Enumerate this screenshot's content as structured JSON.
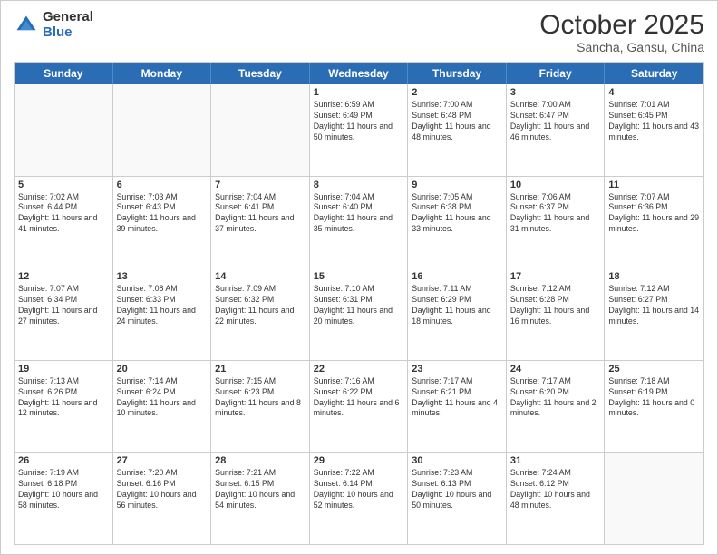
{
  "header": {
    "logo_general": "General",
    "logo_blue": "Blue",
    "month": "October 2025",
    "location": "Sancha, Gansu, China"
  },
  "weekdays": [
    "Sunday",
    "Monday",
    "Tuesday",
    "Wednesday",
    "Thursday",
    "Friday",
    "Saturday"
  ],
  "weeks": [
    [
      {
        "day": "",
        "text": ""
      },
      {
        "day": "",
        "text": ""
      },
      {
        "day": "",
        "text": ""
      },
      {
        "day": "1",
        "text": "Sunrise: 6:59 AM\nSunset: 6:49 PM\nDaylight: 11 hours and 50 minutes."
      },
      {
        "day": "2",
        "text": "Sunrise: 7:00 AM\nSunset: 6:48 PM\nDaylight: 11 hours and 48 minutes."
      },
      {
        "day": "3",
        "text": "Sunrise: 7:00 AM\nSunset: 6:47 PM\nDaylight: 11 hours and 46 minutes."
      },
      {
        "day": "4",
        "text": "Sunrise: 7:01 AM\nSunset: 6:45 PM\nDaylight: 11 hours and 43 minutes."
      }
    ],
    [
      {
        "day": "5",
        "text": "Sunrise: 7:02 AM\nSunset: 6:44 PM\nDaylight: 11 hours and 41 minutes."
      },
      {
        "day": "6",
        "text": "Sunrise: 7:03 AM\nSunset: 6:43 PM\nDaylight: 11 hours and 39 minutes."
      },
      {
        "day": "7",
        "text": "Sunrise: 7:04 AM\nSunset: 6:41 PM\nDaylight: 11 hours and 37 minutes."
      },
      {
        "day": "8",
        "text": "Sunrise: 7:04 AM\nSunset: 6:40 PM\nDaylight: 11 hours and 35 minutes."
      },
      {
        "day": "9",
        "text": "Sunrise: 7:05 AM\nSunset: 6:38 PM\nDaylight: 11 hours and 33 minutes."
      },
      {
        "day": "10",
        "text": "Sunrise: 7:06 AM\nSunset: 6:37 PM\nDaylight: 11 hours and 31 minutes."
      },
      {
        "day": "11",
        "text": "Sunrise: 7:07 AM\nSunset: 6:36 PM\nDaylight: 11 hours and 29 minutes."
      }
    ],
    [
      {
        "day": "12",
        "text": "Sunrise: 7:07 AM\nSunset: 6:34 PM\nDaylight: 11 hours and 27 minutes."
      },
      {
        "day": "13",
        "text": "Sunrise: 7:08 AM\nSunset: 6:33 PM\nDaylight: 11 hours and 24 minutes."
      },
      {
        "day": "14",
        "text": "Sunrise: 7:09 AM\nSunset: 6:32 PM\nDaylight: 11 hours and 22 minutes."
      },
      {
        "day": "15",
        "text": "Sunrise: 7:10 AM\nSunset: 6:31 PM\nDaylight: 11 hours and 20 minutes."
      },
      {
        "day": "16",
        "text": "Sunrise: 7:11 AM\nSunset: 6:29 PM\nDaylight: 11 hours and 18 minutes."
      },
      {
        "day": "17",
        "text": "Sunrise: 7:12 AM\nSunset: 6:28 PM\nDaylight: 11 hours and 16 minutes."
      },
      {
        "day": "18",
        "text": "Sunrise: 7:12 AM\nSunset: 6:27 PM\nDaylight: 11 hours and 14 minutes."
      }
    ],
    [
      {
        "day": "19",
        "text": "Sunrise: 7:13 AM\nSunset: 6:26 PM\nDaylight: 11 hours and 12 minutes."
      },
      {
        "day": "20",
        "text": "Sunrise: 7:14 AM\nSunset: 6:24 PM\nDaylight: 11 hours and 10 minutes."
      },
      {
        "day": "21",
        "text": "Sunrise: 7:15 AM\nSunset: 6:23 PM\nDaylight: 11 hours and 8 minutes."
      },
      {
        "day": "22",
        "text": "Sunrise: 7:16 AM\nSunset: 6:22 PM\nDaylight: 11 hours and 6 minutes."
      },
      {
        "day": "23",
        "text": "Sunrise: 7:17 AM\nSunset: 6:21 PM\nDaylight: 11 hours and 4 minutes."
      },
      {
        "day": "24",
        "text": "Sunrise: 7:17 AM\nSunset: 6:20 PM\nDaylight: 11 hours and 2 minutes."
      },
      {
        "day": "25",
        "text": "Sunrise: 7:18 AM\nSunset: 6:19 PM\nDaylight: 11 hours and 0 minutes."
      }
    ],
    [
      {
        "day": "26",
        "text": "Sunrise: 7:19 AM\nSunset: 6:18 PM\nDaylight: 10 hours and 58 minutes."
      },
      {
        "day": "27",
        "text": "Sunrise: 7:20 AM\nSunset: 6:16 PM\nDaylight: 10 hours and 56 minutes."
      },
      {
        "day": "28",
        "text": "Sunrise: 7:21 AM\nSunset: 6:15 PM\nDaylight: 10 hours and 54 minutes."
      },
      {
        "day": "29",
        "text": "Sunrise: 7:22 AM\nSunset: 6:14 PM\nDaylight: 10 hours and 52 minutes."
      },
      {
        "day": "30",
        "text": "Sunrise: 7:23 AM\nSunset: 6:13 PM\nDaylight: 10 hours and 50 minutes."
      },
      {
        "day": "31",
        "text": "Sunrise: 7:24 AM\nSunset: 6:12 PM\nDaylight: 10 hours and 48 minutes."
      },
      {
        "day": "",
        "text": ""
      }
    ]
  ]
}
